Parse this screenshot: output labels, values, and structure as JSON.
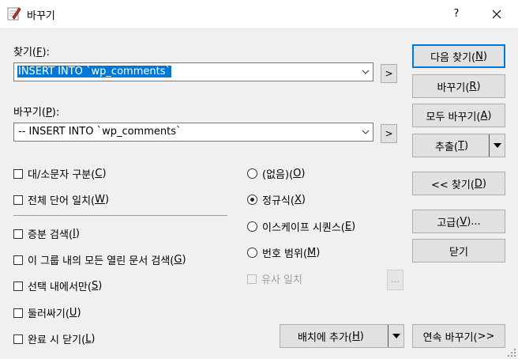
{
  "window": {
    "title": "바꾸기",
    "help": "?"
  },
  "find": {
    "label_pre": "찾기(",
    "label_key": "F",
    "label_post": "):",
    "value": "INSERT INTO `wp_comments`",
    "more": ">"
  },
  "replace": {
    "label_pre": "바꾸기(",
    "label_key": "P",
    "label_post": "):",
    "value": "-- INSERT INTO `wp_comments`",
    "more": ">"
  },
  "options": {
    "match_case": {
      "pre": "대/소문자 구분(",
      "key": "C",
      "post": ")",
      "checked": false
    },
    "whole_word": {
      "pre": "전체 단어 일치(",
      "key": "W",
      "post": ")",
      "checked": false
    },
    "incremental": {
      "pre": "증분 검색(",
      "key": "I",
      "post": ")",
      "checked": false
    },
    "all_open_docs": {
      "pre": "이 그룹 내의 모든 열린 문서 검색(",
      "key": "G",
      "post": ")",
      "checked": false
    },
    "in_selection": {
      "pre": "선택 내에서만(",
      "key": "S",
      "post": ")",
      "checked": false
    },
    "wrap": {
      "pre": "둘러싸기(",
      "key": "U",
      "post": ")",
      "checked": false
    },
    "close_on_done": {
      "pre": "완료 시 닫기(",
      "key": "L",
      "post": ")",
      "checked": false
    }
  },
  "modes": {
    "none": {
      "pre": "(없음)(",
      "key": "O",
      "post": ")"
    },
    "regex": {
      "pre": "정규식(",
      "key": "X",
      "post": ")"
    },
    "escape": {
      "pre": "이스케이프 시퀀스(",
      "key": "E",
      "post": ")"
    },
    "range": {
      "pre": "번호 범위(",
      "key": "M",
      "post": ")"
    },
    "selected": "regex",
    "similar": "유사 일치",
    "similar_btn": "..."
  },
  "buttons": {
    "find_next": {
      "pre": "다음 찾기(",
      "key": "N",
      "post": ")"
    },
    "replace": {
      "pre": "바꾸기(",
      "key": "R",
      "post": ")"
    },
    "replace_all": {
      "pre": "모두 바꾸기(",
      "key": "A",
      "post": ")"
    },
    "extract": {
      "pre": "추출(",
      "key": "T",
      "post": ")"
    },
    "find_prev": {
      "pre": "<< 찾기(",
      "key": "D",
      "post": ")"
    },
    "advanced": {
      "pre": "고급(",
      "key": "V",
      "post": ")..."
    },
    "close": "닫기",
    "add_batch": {
      "pre": "배치에 추가(",
      "key": "H",
      "post": ")"
    },
    "continuous": {
      "pre": "연속 바꾸기(",
      "key": "",
      "post": " >>"
    }
  }
}
